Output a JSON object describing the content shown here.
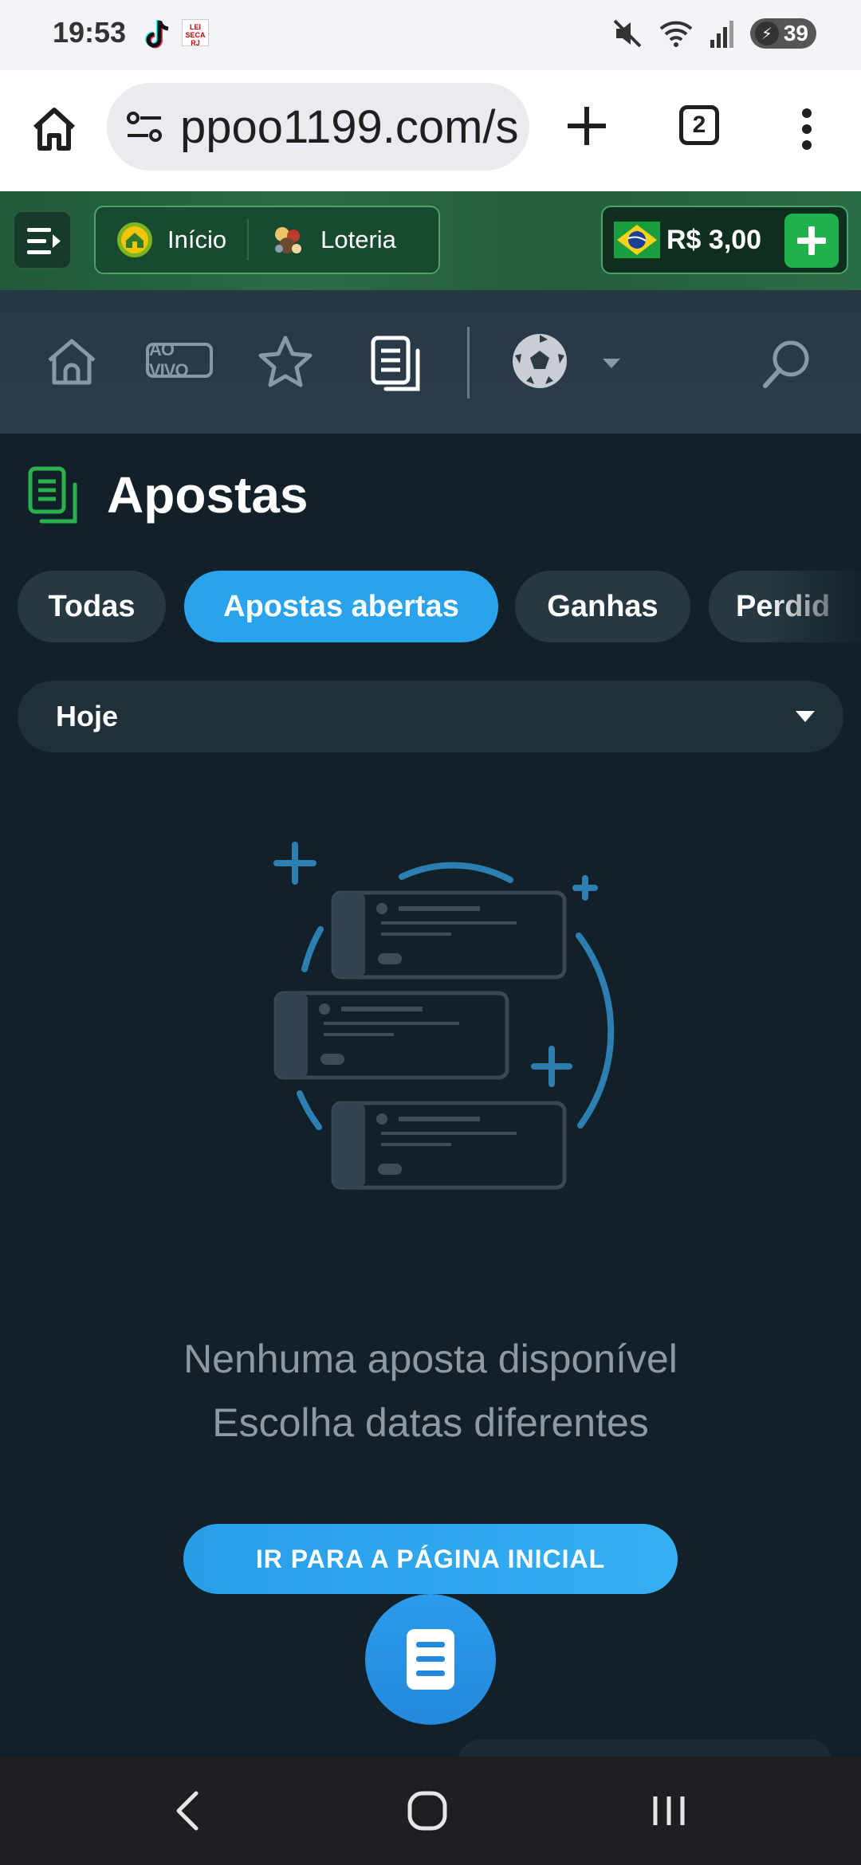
{
  "status_bar": {
    "time": "19:53",
    "battery": "39",
    "news_icon_text": "LEI SECA RJ"
  },
  "browser": {
    "url": "ppoo1199.com/s",
    "tab_count": "2"
  },
  "header": {
    "nav_home_label": "Início",
    "nav_lottery_label": "Loteria",
    "balance": "R$ 3,00"
  },
  "sport_nav": {
    "live_label": "AO VIVO"
  },
  "page": {
    "title": "Apostas"
  },
  "filter_tabs": [
    {
      "label": "Todas",
      "active": false
    },
    {
      "label": "Apostas abertas",
      "active": true
    },
    {
      "label": "Ganhas",
      "active": false
    },
    {
      "label": "Perdid",
      "active": false
    }
  ],
  "date_filter": {
    "selected": "Hoje"
  },
  "empty_state": {
    "line1": "Nenhuma aposta disponível",
    "line2": "Escolha datas diferentes",
    "button_label": "IR PARA A PÁGINA INICIAL"
  },
  "colors": {
    "accent_blue": "#2aa3ee",
    "header_green": "#2b6b45",
    "background": "#122029"
  }
}
